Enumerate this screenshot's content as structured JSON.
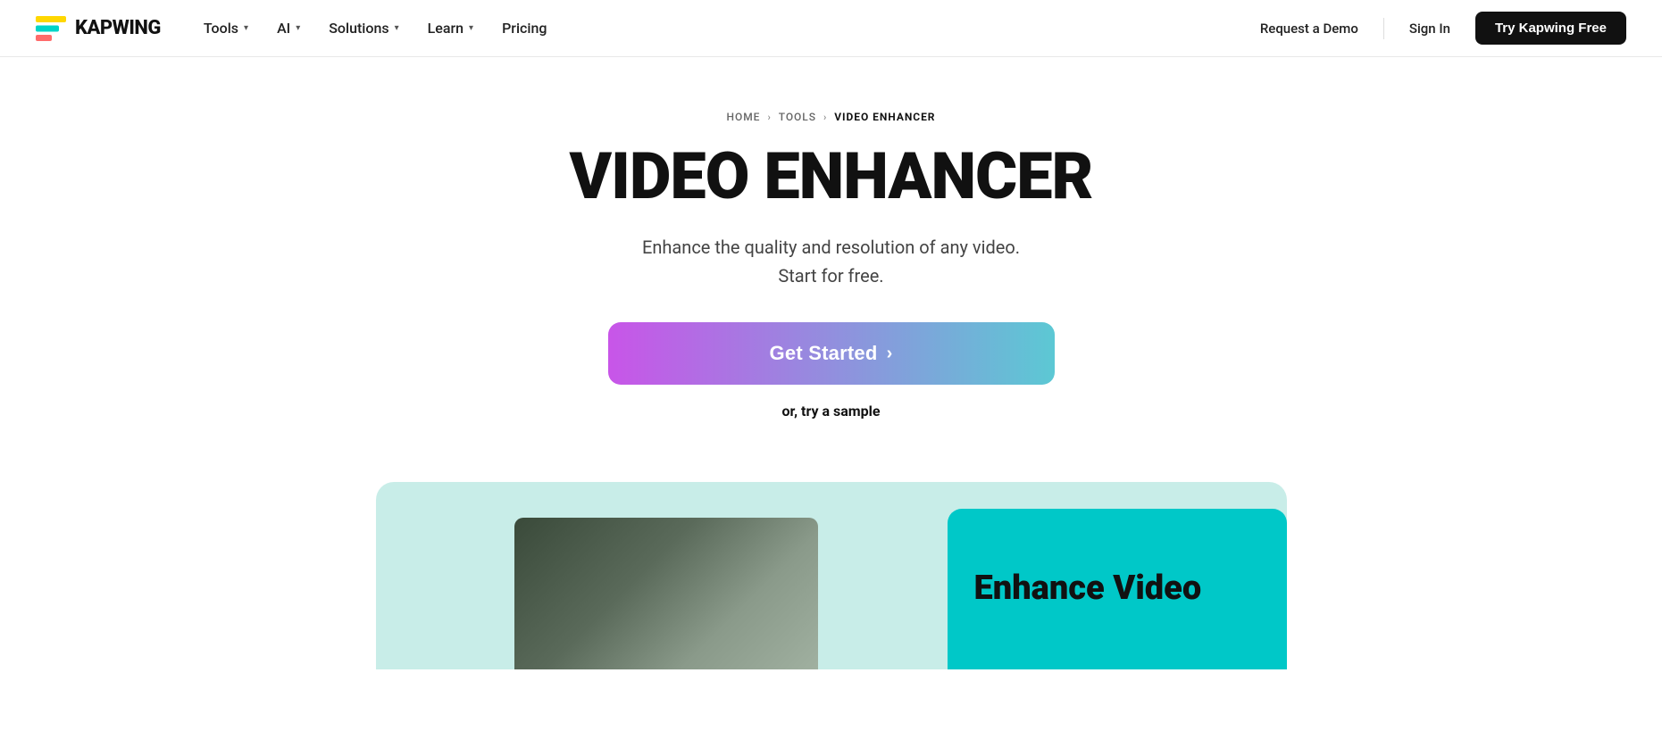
{
  "brand": {
    "name": "KAPWING"
  },
  "navbar": {
    "tools_label": "Tools",
    "ai_label": "AI",
    "solutions_label": "Solutions",
    "learn_label": "Learn",
    "pricing_label": "Pricing",
    "request_demo_label": "Request a Demo",
    "sign_in_label": "Sign In",
    "try_free_label": "Try Kapwing Free"
  },
  "breadcrumb": {
    "home": "HOME",
    "tools": "TOOLS",
    "current": "VIDEO ENHANCER"
  },
  "hero": {
    "title": "VIDEO ENHANCER",
    "subtitle_line1": "Enhance the quality and resolution of any video.",
    "subtitle_line2": "Start for free.",
    "cta_label": "Get Started",
    "cta_chevron": "›",
    "try_sample_label": "or, try a sample"
  },
  "preview": {
    "enhance_title_line1": "Enhance Video"
  }
}
